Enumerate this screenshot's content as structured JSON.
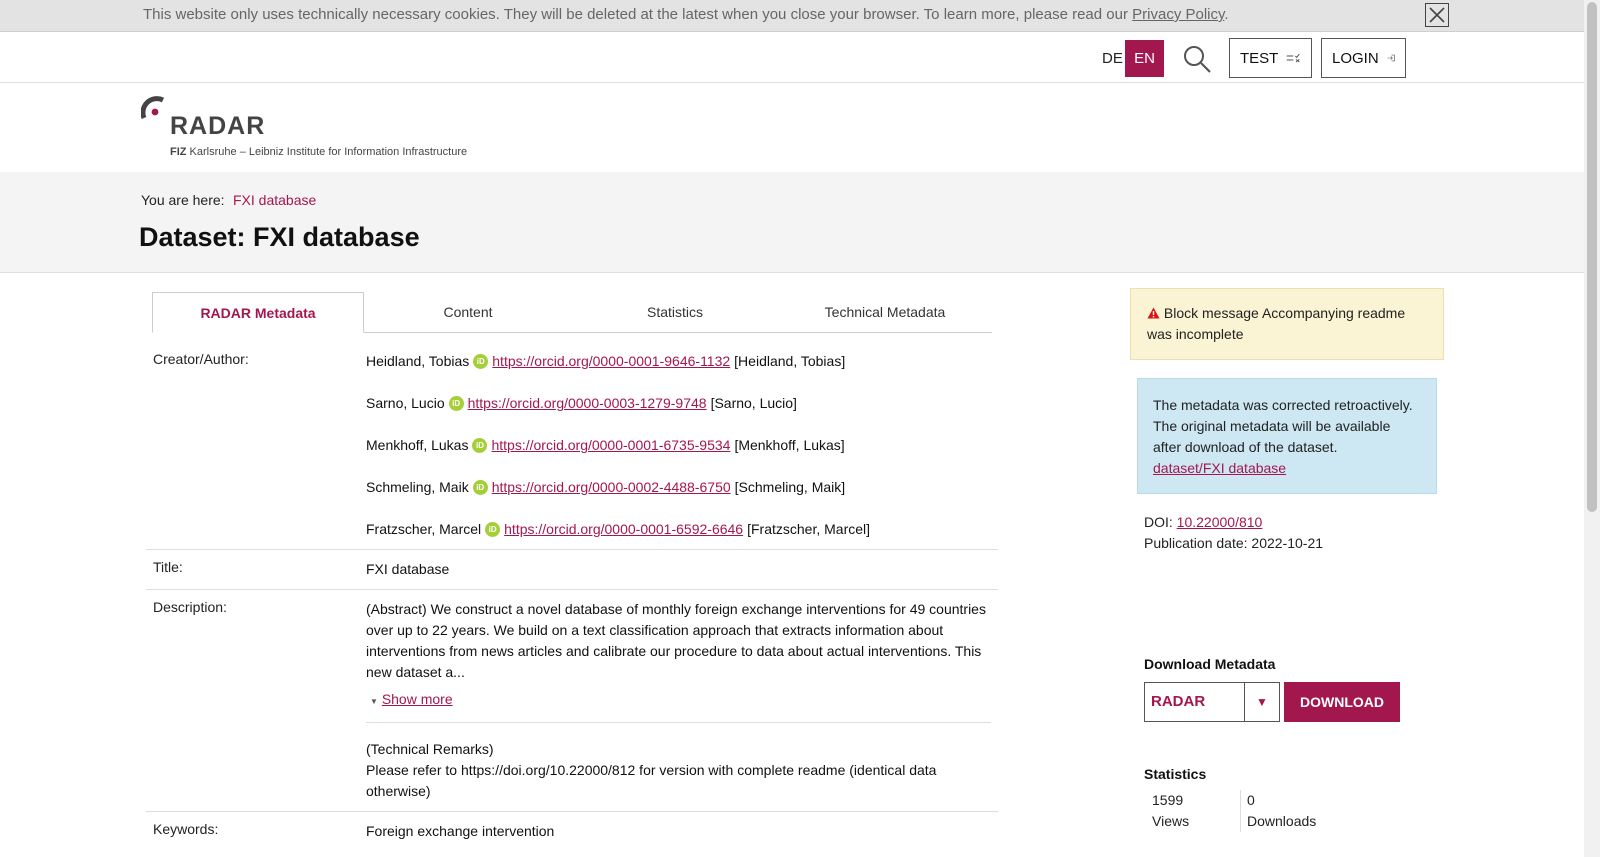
{
  "cookie": {
    "text": "This website only uses technically necessary cookies. They will be deleted at the latest when you close your browser. To learn more, please read our ",
    "link": "Privacy Policy",
    "suffix": "."
  },
  "topbar": {
    "lang_de": "DE",
    "lang_en": "EN",
    "test_label": "TEST",
    "login_label": "LOGIN"
  },
  "logo": {
    "name": "RADAR",
    "subtitle_bold": "FIZ",
    "subtitle": " Karlsruhe – Leibniz Institute for Information Infrastructure"
  },
  "breadcrumb": {
    "label": "You are here:",
    "current": "FXI database"
  },
  "page_title": "Dataset: FXI database",
  "tabs": [
    "RADAR Metadata",
    "Content",
    "Statistics",
    "Technical Metadata"
  ],
  "metadata": {
    "creator_label": "Creator/Author:",
    "creators": [
      {
        "name": "Heidland, Tobias",
        "orcid": "https://orcid.org/0000-0001-9646-1132",
        "alias": "[Heidland, Tobias]"
      },
      {
        "name": "Sarno, Lucio",
        "orcid": "https://orcid.org/0000-0003-1279-9748",
        "alias": "[Sarno, Lucio]"
      },
      {
        "name": "Menkhoff, Lukas",
        "orcid": "https://orcid.org/0000-0001-6735-9534",
        "alias": "[Menkhoff, Lukas]"
      },
      {
        "name": "Schmeling, Maik",
        "orcid": "https://orcid.org/0000-0002-4488-6750",
        "alias": "[Schmeling, Maik]"
      },
      {
        "name": "Fratzscher, Marcel",
        "orcid": "https://orcid.org/0000-0001-6592-6646",
        "alias": "[Fratzscher, Marcel]"
      }
    ],
    "title_label": "Title:",
    "title_value": "FXI database",
    "description_label": "Description:",
    "abstract": "(Abstract) We construct a novel database of monthly foreign exchange interventions for 49 countries over up to 22 years. We build on a text classification approach that extracts information about interventions from news articles and calibrate our procedure to data about actual interventions. This new dataset a...",
    "show_more": "Show more",
    "remarks_title": "(Technical Remarks)",
    "remarks_text": "Please refer to https://doi.org/10.22000/812 for version with complete readme (identical data otherwise)",
    "keywords_label": "Keywords:",
    "keywords_value": "Foreign exchange intervention"
  },
  "sidebar": {
    "warning": "Block message Accompanying readme was incomplete",
    "info_text": "The metadata was corrected retroactively. The original metadata will be available after download of the dataset.",
    "info_link": "dataset/FXI database",
    "doi_label": "DOI:",
    "doi_value": "10.22000/810",
    "pubdate": "Publication date: 2022-10-21",
    "download_title": "Download Metadata",
    "format_selected": "RADAR",
    "download_button": "DOWNLOAD",
    "stats_title": "Statistics",
    "views_count": "1599",
    "views_label": "Views",
    "downloads_count": "0",
    "downloads_label": "Downloads"
  },
  "colors": {
    "accent": "#a3174f",
    "warning_bg": "#faf3d4",
    "info_bg": "#cde8f3",
    "orcid": "#a6ce39"
  }
}
